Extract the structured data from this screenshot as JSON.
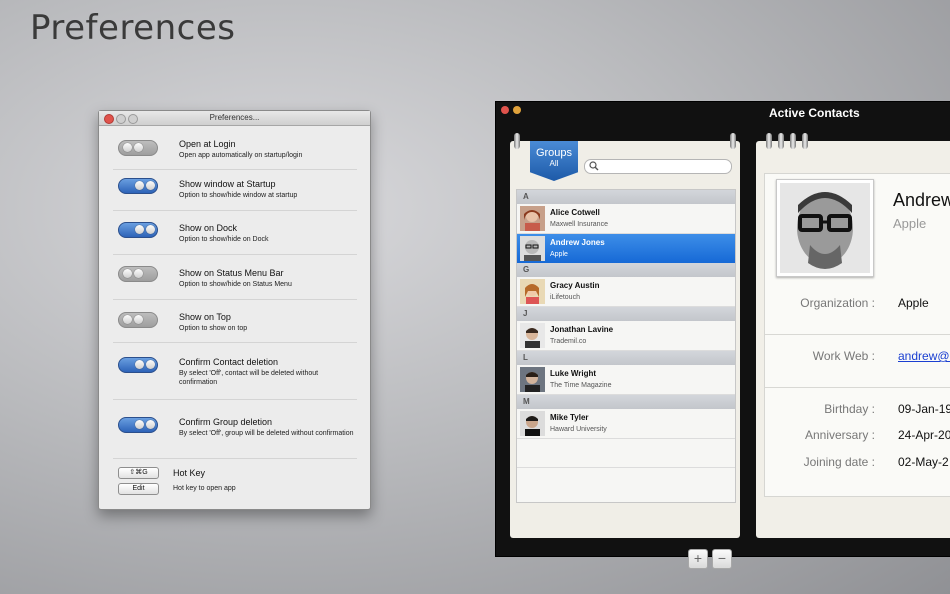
{
  "hero_title": "Preferences",
  "prefs_window": {
    "title": "Preferences...",
    "options": [
      {
        "title": "Open at Login",
        "desc": "Open app automatically on startup/login",
        "state": "off"
      },
      {
        "title": "Show window at Startup",
        "desc": "Option to show/hide window at startup",
        "state": "on"
      },
      {
        "title": "Show on Dock",
        "desc": "Option to show/hide on Dock",
        "state": "on"
      },
      {
        "title": "Show on Status Menu Bar",
        "desc": "Option to show/hide on Status Menu",
        "state": "off"
      },
      {
        "title": "Show on Top",
        "desc": "Option to show on top",
        "state": "off"
      },
      {
        "title": "Confirm Contact deletion",
        "desc": "By select 'Off', contact will be deleted without confirmation",
        "state": "on"
      },
      {
        "title": "Confirm Group deletion",
        "desc": "By select 'Off', group will be deleted without confirmation",
        "state": "on"
      }
    ],
    "hotkey": {
      "shortcut": "⇧⌘G",
      "edit_label": "Edit",
      "title": "Hot Key",
      "desc": "Hot key to open app"
    }
  },
  "contacts_app": {
    "window_title": "Active Contacts",
    "groups_label": "Groups",
    "groups_sub": "All",
    "search_icon": "magnifier-icon",
    "sections": [
      {
        "letter": "A",
        "contacts": [
          {
            "name": "Alice Cotwell",
            "org": "Maxwell Insurance",
            "selected": false
          },
          {
            "name": "Andrew Jones",
            "org": "Apple",
            "selected": true
          }
        ]
      },
      {
        "letter": "G",
        "contacts": [
          {
            "name": "Gracy  Austin",
            "org": "iLifetouch",
            "selected": false
          }
        ]
      },
      {
        "letter": "J",
        "contacts": [
          {
            "name": "Jonathan  Lavine",
            "org": "Trademil.co",
            "selected": false
          }
        ]
      },
      {
        "letter": "L",
        "contacts": [
          {
            "name": "Luke Wright",
            "org": "The Time Magazine",
            "selected": false
          }
        ]
      },
      {
        "letter": "M",
        "contacts": [
          {
            "name": "Mike Tyler",
            "org": "Haward University",
            "selected": false
          }
        ]
      }
    ],
    "add_label": "+",
    "remove_label": "−",
    "detail": {
      "name": "Andrew",
      "company": "Apple",
      "organization_label": "Organization :",
      "organization_value": "Apple",
      "work_web_label": "Work Web :",
      "work_web_value": "andrew@h",
      "birthday_label": "Birthday :",
      "birthday_value": "09-Jan-19",
      "anniversary_label": "Anniversary :",
      "anniversary_value": "24-Apr-20",
      "joining_label": "Joining date :",
      "joining_value": "02-May-2"
    }
  },
  "colors": {
    "selection": "#1669d6",
    "toggle_on": "#2d63b8",
    "link": "#1a3fd1",
    "groups_tab": "#1d5aa8"
  }
}
